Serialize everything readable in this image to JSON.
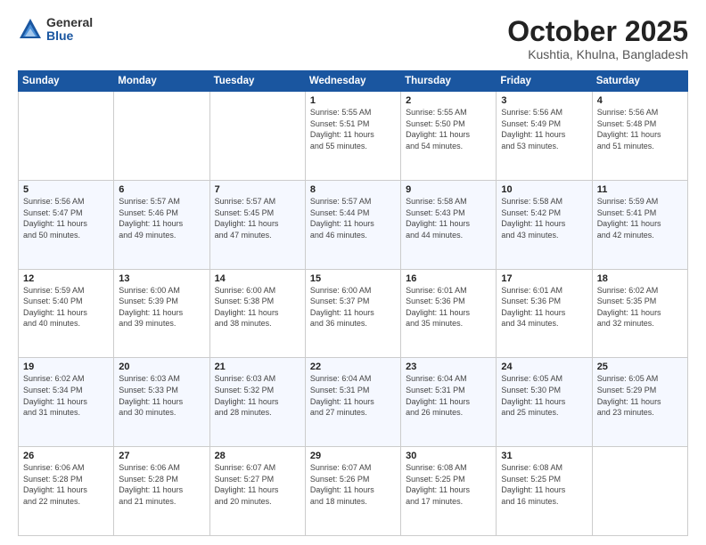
{
  "logo": {
    "general": "General",
    "blue": "Blue"
  },
  "header": {
    "month": "October 2025",
    "location": "Kushtia, Khulna, Bangladesh"
  },
  "weekdays": [
    "Sunday",
    "Monday",
    "Tuesday",
    "Wednesday",
    "Thursday",
    "Friday",
    "Saturday"
  ],
  "weeks": [
    [
      {
        "day": "",
        "info": ""
      },
      {
        "day": "",
        "info": ""
      },
      {
        "day": "",
        "info": ""
      },
      {
        "day": "1",
        "info": "Sunrise: 5:55 AM\nSunset: 5:51 PM\nDaylight: 11 hours\nand 55 minutes."
      },
      {
        "day": "2",
        "info": "Sunrise: 5:55 AM\nSunset: 5:50 PM\nDaylight: 11 hours\nand 54 minutes."
      },
      {
        "day": "3",
        "info": "Sunrise: 5:56 AM\nSunset: 5:49 PM\nDaylight: 11 hours\nand 53 minutes."
      },
      {
        "day": "4",
        "info": "Sunrise: 5:56 AM\nSunset: 5:48 PM\nDaylight: 11 hours\nand 51 minutes."
      }
    ],
    [
      {
        "day": "5",
        "info": "Sunrise: 5:56 AM\nSunset: 5:47 PM\nDaylight: 11 hours\nand 50 minutes."
      },
      {
        "day": "6",
        "info": "Sunrise: 5:57 AM\nSunset: 5:46 PM\nDaylight: 11 hours\nand 49 minutes."
      },
      {
        "day": "7",
        "info": "Sunrise: 5:57 AM\nSunset: 5:45 PM\nDaylight: 11 hours\nand 47 minutes."
      },
      {
        "day": "8",
        "info": "Sunrise: 5:57 AM\nSunset: 5:44 PM\nDaylight: 11 hours\nand 46 minutes."
      },
      {
        "day": "9",
        "info": "Sunrise: 5:58 AM\nSunset: 5:43 PM\nDaylight: 11 hours\nand 44 minutes."
      },
      {
        "day": "10",
        "info": "Sunrise: 5:58 AM\nSunset: 5:42 PM\nDaylight: 11 hours\nand 43 minutes."
      },
      {
        "day": "11",
        "info": "Sunrise: 5:59 AM\nSunset: 5:41 PM\nDaylight: 11 hours\nand 42 minutes."
      }
    ],
    [
      {
        "day": "12",
        "info": "Sunrise: 5:59 AM\nSunset: 5:40 PM\nDaylight: 11 hours\nand 40 minutes."
      },
      {
        "day": "13",
        "info": "Sunrise: 6:00 AM\nSunset: 5:39 PM\nDaylight: 11 hours\nand 39 minutes."
      },
      {
        "day": "14",
        "info": "Sunrise: 6:00 AM\nSunset: 5:38 PM\nDaylight: 11 hours\nand 38 minutes."
      },
      {
        "day": "15",
        "info": "Sunrise: 6:00 AM\nSunset: 5:37 PM\nDaylight: 11 hours\nand 36 minutes."
      },
      {
        "day": "16",
        "info": "Sunrise: 6:01 AM\nSunset: 5:36 PM\nDaylight: 11 hours\nand 35 minutes."
      },
      {
        "day": "17",
        "info": "Sunrise: 6:01 AM\nSunset: 5:36 PM\nDaylight: 11 hours\nand 34 minutes."
      },
      {
        "day": "18",
        "info": "Sunrise: 6:02 AM\nSunset: 5:35 PM\nDaylight: 11 hours\nand 32 minutes."
      }
    ],
    [
      {
        "day": "19",
        "info": "Sunrise: 6:02 AM\nSunset: 5:34 PM\nDaylight: 11 hours\nand 31 minutes."
      },
      {
        "day": "20",
        "info": "Sunrise: 6:03 AM\nSunset: 5:33 PM\nDaylight: 11 hours\nand 30 minutes."
      },
      {
        "day": "21",
        "info": "Sunrise: 6:03 AM\nSunset: 5:32 PM\nDaylight: 11 hours\nand 28 minutes."
      },
      {
        "day": "22",
        "info": "Sunrise: 6:04 AM\nSunset: 5:31 PM\nDaylight: 11 hours\nand 27 minutes."
      },
      {
        "day": "23",
        "info": "Sunrise: 6:04 AM\nSunset: 5:31 PM\nDaylight: 11 hours\nand 26 minutes."
      },
      {
        "day": "24",
        "info": "Sunrise: 6:05 AM\nSunset: 5:30 PM\nDaylight: 11 hours\nand 25 minutes."
      },
      {
        "day": "25",
        "info": "Sunrise: 6:05 AM\nSunset: 5:29 PM\nDaylight: 11 hours\nand 23 minutes."
      }
    ],
    [
      {
        "day": "26",
        "info": "Sunrise: 6:06 AM\nSunset: 5:28 PM\nDaylight: 11 hours\nand 22 minutes."
      },
      {
        "day": "27",
        "info": "Sunrise: 6:06 AM\nSunset: 5:28 PM\nDaylight: 11 hours\nand 21 minutes."
      },
      {
        "day": "28",
        "info": "Sunrise: 6:07 AM\nSunset: 5:27 PM\nDaylight: 11 hours\nand 20 minutes."
      },
      {
        "day": "29",
        "info": "Sunrise: 6:07 AM\nSunset: 5:26 PM\nDaylight: 11 hours\nand 18 minutes."
      },
      {
        "day": "30",
        "info": "Sunrise: 6:08 AM\nSunset: 5:25 PM\nDaylight: 11 hours\nand 17 minutes."
      },
      {
        "day": "31",
        "info": "Sunrise: 6:08 AM\nSunset: 5:25 PM\nDaylight: 11 hours\nand 16 minutes."
      },
      {
        "day": "",
        "info": ""
      }
    ]
  ]
}
